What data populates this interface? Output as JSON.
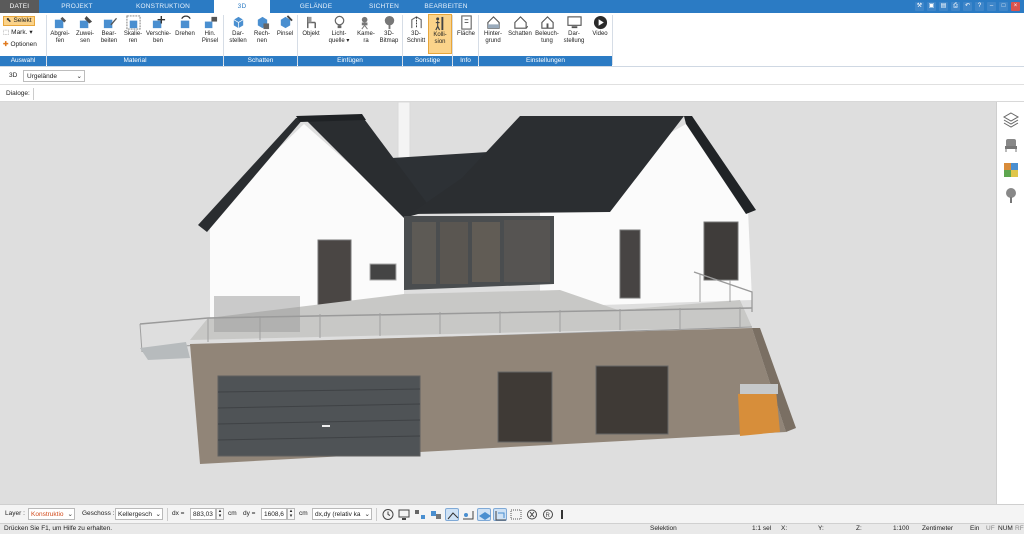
{
  "tabs": [
    {
      "label": "DATEI"
    },
    {
      "label": "PROJEKT"
    },
    {
      "label": "KONSTRUKTION"
    },
    {
      "label": "3D"
    },
    {
      "label": "GELÄNDE"
    },
    {
      "label": "SICHTEN"
    },
    {
      "label": "BEARBEITEN"
    }
  ],
  "ribbon": {
    "auswahl": {
      "selekt": "Selekt",
      "mark": "Mark.",
      "optionen": "Optionen",
      "group": "Auswahl"
    },
    "material": {
      "group": "Material",
      "buttons": [
        {
          "l1": "Abgrei-",
          "l2": "fen"
        },
        {
          "l1": "Zuwei-",
          "l2": "sen"
        },
        {
          "l1": "Bear-",
          "l2": "beiten"
        },
        {
          "l1": "Skalie-",
          "l2": "ren"
        },
        {
          "l1": "Verschie-",
          "l2": "ben"
        },
        {
          "l1": "Drehen",
          "l2": ""
        },
        {
          "l1": "Hin.",
          "l2": "Pinsel"
        }
      ]
    },
    "schatten": {
      "group": "Schatten",
      "buttons": [
        {
          "l1": "Dar-",
          "l2": "stellen"
        },
        {
          "l1": "Rech-",
          "l2": "nen"
        },
        {
          "l1": "Pinsel",
          "l2": ""
        }
      ]
    },
    "einfuegen": {
      "group": "Einfügen",
      "buttons": [
        {
          "l1": "Objekt",
          "l2": ""
        },
        {
          "l1": "Licht-",
          "l2": "quelle ▾"
        },
        {
          "l1": "Kame-",
          "l2": "ra"
        },
        {
          "l1": "3D-",
          "l2": "Bitmap"
        }
      ]
    },
    "sonstige": {
      "group": "Sonstige",
      "buttons": [
        {
          "l1": "3D-",
          "l2": "Schnitt"
        },
        {
          "l1": "Kolli-",
          "l2": "sion"
        }
      ]
    },
    "info": {
      "group": "Info",
      "buttons": [
        {
          "l1": "Fläche",
          "l2": ""
        }
      ]
    },
    "einstellungen": {
      "group": "Einstellungen",
      "buttons": [
        {
          "l1": "Hinter-",
          "l2": "grund"
        },
        {
          "l1": "Schatten",
          "l2": ""
        },
        {
          "l1": "Beleuch-",
          "l2": "tung"
        },
        {
          "l1": "Dar-",
          "l2": "stellung"
        },
        {
          "l1": "Video",
          "l2": ""
        }
      ]
    }
  },
  "viewbar": {
    "mode": "3D",
    "terrain": "Urgelände"
  },
  "dialoge": "Dialoge:",
  "bottom": {
    "layer_label": "Layer :",
    "layer_value": "Konstruktio",
    "geschoss_label": "Geschoss :",
    "geschoss_value": "Kellergesch",
    "dx_label": "dx =",
    "dx_value": "883,03",
    "dx_unit": "cm",
    "dy_label": "dy =",
    "dy_value": "1608,6",
    "dy_unit": "cm",
    "coord_mode": "dx,dy (relativ ka"
  },
  "status": {
    "help": "Drücken Sie F1, um Hilfe zu erhalten.",
    "mode": "Selektion",
    "sel": "1:1 sel",
    "x": "X:",
    "y": "Y:",
    "z": "Z:",
    "scale": "1:100",
    "unit": "Zentimeter",
    "ein": "Ein",
    "uf": "UF",
    "num": "NUM",
    "rf": "RF"
  },
  "colors": {
    "accent": "#2b7bc4",
    "highlight": "#fbd38a",
    "facade": "#918578",
    "roof": "#2a2d30"
  }
}
